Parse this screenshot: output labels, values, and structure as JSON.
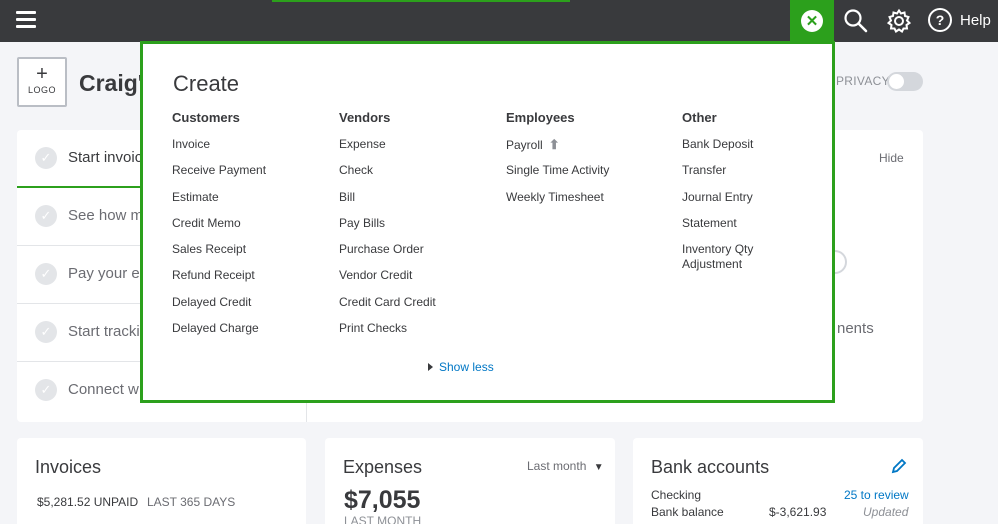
{
  "topbar": {
    "help_label": "Help",
    "help_icon_text": "?",
    "close_icon_text": "✕"
  },
  "header": {
    "logo_plus": "+",
    "logo_text": "LOGO",
    "company_name": "Craig's",
    "privacy_label": "PRIVACY"
  },
  "setup": {
    "hide_label": "Hide",
    "partial_text": "nents",
    "tasks": [
      {
        "label": "Start invoic"
      },
      {
        "label": "See how m"
      },
      {
        "label": "Pay your er"
      },
      {
        "label": "Start tracki"
      },
      {
        "label": "Connect w"
      }
    ]
  },
  "create": {
    "title": "Create",
    "columns": [
      {
        "heading": "Customers",
        "items": [
          "Invoice",
          "Receive Payment",
          "Estimate",
          "Credit Memo",
          "Sales Receipt",
          "Refund Receipt",
          "Delayed Credit",
          "Delayed Charge"
        ]
      },
      {
        "heading": "Vendors",
        "items": [
          "Expense",
          "Check",
          "Bill",
          "Pay Bills",
          "Purchase Order",
          "Vendor Credit",
          "Credit Card Credit",
          "Print Checks"
        ]
      },
      {
        "heading": "Employees",
        "items": [
          "Payroll",
          "Single Time Activity",
          "Weekly Timesheet"
        ]
      },
      {
        "heading": "Other",
        "items": [
          "Bank Deposit",
          "Transfer",
          "Journal Entry",
          "Statement",
          "Inventory Qty Adjustment"
        ]
      }
    ],
    "show_less": "Show less"
  },
  "cards": {
    "invoices": {
      "title": "Invoices",
      "unpaid": "$5,281.52 UNPAID",
      "period": "LAST 365 DAYS"
    },
    "expenses": {
      "title": "Expenses",
      "period": "Last month",
      "amount": "$7,055",
      "subtitle": "LAST MONTH"
    },
    "bank": {
      "title": "Bank accounts",
      "account": "Checking",
      "review": "25 to review",
      "balance_label": "Bank balance",
      "balance": "$-3,621.93",
      "updated": "Updated"
    }
  },
  "colors": {
    "accent": "#2ca01c",
    "topbar": "#393a3d",
    "link": "#0077c5"
  }
}
